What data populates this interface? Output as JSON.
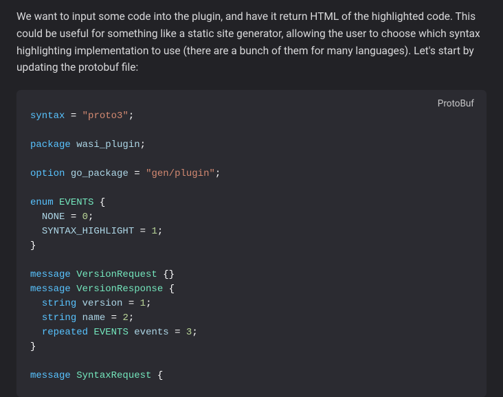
{
  "prose": "We want to input some code into the plugin, and have it return HTML of the highlighted code. This could be useful for something like a static site generator, allowing the user to choose which syntax highlighting implementation to use (there are a bunch of them for many languages). Let's start by updating the protobuf file:",
  "code_language_label": "ProtoBuf",
  "code": {
    "syntax_kw": "syntax",
    "package_kw": "package",
    "option_kw": "option",
    "enum_kw": "enum",
    "message_kw": "message",
    "string_kw": "string",
    "repeated_kw": "repeated",
    "eq": "=",
    "semi": ";",
    "lbrace": "{",
    "rbrace": "}",
    "empty_braces": "{}",
    "proto3_str": "\"proto3\"",
    "package_name": "wasi_plugin",
    "go_package_name": "go_package",
    "go_package_str": "\"gen/plugin\"",
    "events_type": "EVENTS",
    "none_name": "NONE",
    "syntax_highlight_name": "SYNTAX_HIGHLIGHT",
    "zero": "0",
    "one": "1",
    "two": "2",
    "three": "3",
    "version_request_type": "VersionRequest",
    "version_response_type": "VersionResponse",
    "version_field": "version",
    "name_field": "name",
    "events_field": "events",
    "syntax_request_type": "SyntaxRequest"
  }
}
